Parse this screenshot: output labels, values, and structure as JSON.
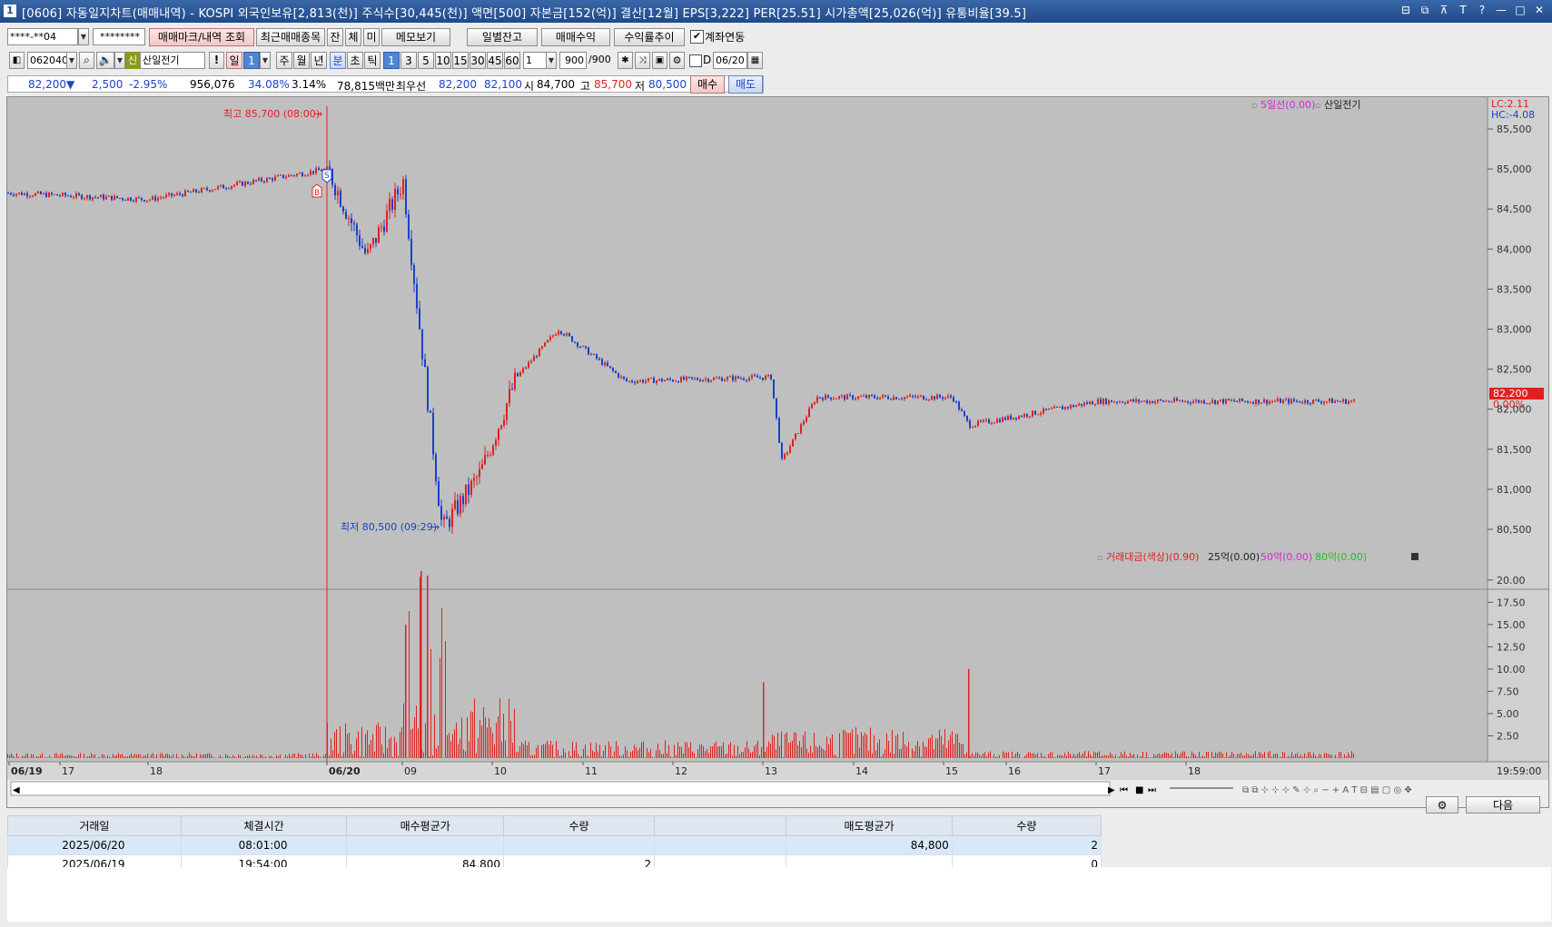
{
  "title": {
    "icon": "1",
    "text": "[0606] 자동일지차트(매매내역) - KOSPI 외국인보유[2,813(천)] 주식수[30,445(천)] 액면[500] 자본금[152(억)] 결산[12월] EPS[3,222] PER[25.51] 시가총액[25,026(억)] 유통비율[39.5]",
    "buttons": [
      "⊟",
      "⧉",
      "⊼",
      "T",
      "?",
      "—",
      "□",
      "✕"
    ]
  },
  "toolbar1": {
    "account": "****-**04",
    "password": "********",
    "btn_trade_mark": "매매마크/내역 조회",
    "btn_recent": "최근매매종목",
    "btn_jan": "잔",
    "btn_che": "체",
    "btn_mi": "미",
    "btn_memo": "메모보기",
    "btn_daily_balance": "일별잔고",
    "btn_trade_profit": "매매수익",
    "btn_profit_trend": "수익률추이",
    "chk_account_link": "계좌연동"
  },
  "toolbar2": {
    "code": "062040",
    "shin": "신",
    "stock_name": "산일전기",
    "excl": "!",
    "period_day": "일",
    "period_num": "1",
    "periods": [
      "주",
      "월",
      "년",
      "분",
      "초",
      "틱"
    ],
    "minutes": [
      "1",
      "3",
      "5",
      "10",
      "15",
      "30",
      "45",
      "60"
    ],
    "unit_value": "1",
    "count": "900",
    "count_total": "/900",
    "d_label": "D",
    "date": "06/20"
  },
  "quote": {
    "price": "82,200",
    "arrow": "▼",
    "change": "2,500",
    "change_pct": "-2.95%",
    "volume": "956,076",
    "volume_ratio": "34.08%",
    "turnover": "3.14%",
    "amount": "78,815백만",
    "best_label": "최우선",
    "best_ask": "82,200",
    "best_bid": "82,100",
    "open_label": "시",
    "open": "84,700",
    "high_label": "고",
    "high": "85,700",
    "low_label": "저",
    "low": "80,500",
    "buy_btn": "매수",
    "sell_btn": "매도"
  },
  "price_panel": {
    "legend_ma": "5일선(0.00)",
    "legend_name": "산일전기",
    "lc": "LC:2.11",
    "hc": "HC:-4.08",
    "high_label": "최고 85,700 (08:00)",
    "low_label": "최저 80,500 (09:29)",
    "current_price": "82,200",
    "current_pct": "0.00%",
    "marker_s": "S",
    "marker_b": "B",
    "y_ticks": [
      "85,500",
      "85,000",
      "84,500",
      "84,000",
      "83,500",
      "83,000",
      "82,500",
      "82,000",
      "81,500",
      "81,000",
      "80,500"
    ]
  },
  "volume_panel": {
    "legend_main": "거래대금(색상)(0.90)",
    "legend_25": "25억(0.00)",
    "legend_50": "50억(0.00)",
    "legend_80": "80억(0.00)",
    "y_ticks": [
      "20.00",
      "17.50",
      "15.00",
      "12.50",
      "10.00",
      "7.50",
      "5.00",
      "2.50"
    ]
  },
  "x_axis": {
    "labels": [
      "06/19",
      "17",
      "18",
      "06/20",
      "09",
      "10",
      "11",
      "12",
      "13",
      "14",
      "15",
      "16",
      "17",
      "18"
    ],
    "end_time": "19:59:00"
  },
  "bottom_buttons": {
    "next": "다음"
  },
  "trade_table": {
    "headers": [
      "거래일",
      "체결시간",
      "매수평균가",
      "수량",
      "",
      "매도평균가",
      "수량"
    ],
    "rows": [
      [
        "2025/06/20",
        "08:01:00",
        "",
        "",
        "",
        "84,800",
        "2"
      ],
      [
        "2025/06/19",
        "19:54:00",
        "84,800",
        "2",
        "",
        "",
        "0"
      ]
    ]
  },
  "colors": {
    "up": "#e02020",
    "down": "#1d3fc8",
    "chart_bg": "#bfbfbf",
    "titlebar": "#2a569a"
  },
  "chart_data": [
    {
      "type": "line",
      "title": "",
      "xlabel": "",
      "ylabel": "",
      "ylim": [
        80300,
        85700
      ],
      "x": [
        "06/19 17:00",
        "06/19 18:00",
        "06/20 08:00",
        "06/20 08:30",
        "06/20 09:00",
        "06/20 09:29",
        "06/20 09:50",
        "06/20 10:30",
        "06/20 11:00",
        "06/20 12:00",
        "06/20 13:00",
        "06/20 13:15",
        "06/20 14:00",
        "06/20 15:00",
        "06/20 15:30",
        "06/20 17:00",
        "06/20 19:59"
      ],
      "series": [
        {
          "values": [
            84700,
            84620,
            85000,
            83900,
            84850,
            80500,
            81200,
            82400,
            83000,
            82350,
            82400,
            81350,
            82150,
            82150,
            81800,
            82100,
            82100
          ]
        }
      ]
    },
    {
      "type": "bar",
      "title": "",
      "xlabel": "",
      "ylabel": "",
      "ylim": [
        0,
        21
      ],
      "categories": [
        "06/19 17",
        "06/19 18",
        "06/20 08",
        "06/20 09",
        "06/20 10",
        "06/20 11",
        "06/20 12",
        "06/20 13",
        "06/20 14",
        "06/20 15",
        "06/20 16",
        "06/20 17",
        "06/20 18"
      ],
      "values": [
        0.5,
        0.5,
        4.5,
        21.0,
        3.0,
        1.5,
        1.0,
        8.5,
        1.5,
        10.0,
        0.5,
        0.5,
        0.5
      ]
    }
  ]
}
